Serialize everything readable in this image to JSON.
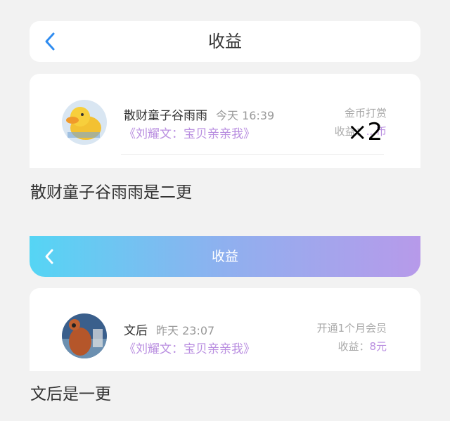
{
  "header1": {
    "title": "收益"
  },
  "entry1": {
    "name": "散财童子谷雨雨",
    "time": "今天 16:39",
    "book": "《刘耀文：宝贝亲亲我》",
    "type": "金币打赏",
    "earning_label": "收益：",
    "earning_value": "...币",
    "overlay": "×2"
  },
  "caption1": "散财童子谷雨雨是二更",
  "header2": {
    "title": "收益"
  },
  "entry2": {
    "name": "文后",
    "time": "昨天 23:07",
    "book": "《刘耀文：宝贝亲亲我》",
    "type": "开通1个月会员",
    "earning_label": "收益：",
    "earning_value": "8元"
  },
  "caption2": "文后是一更",
  "colors": {
    "accent": "#b98ee0",
    "back_blue": "#2f8cf0",
    "gradient_start": "#55d5f4",
    "gradient_end": "#b79aea"
  }
}
